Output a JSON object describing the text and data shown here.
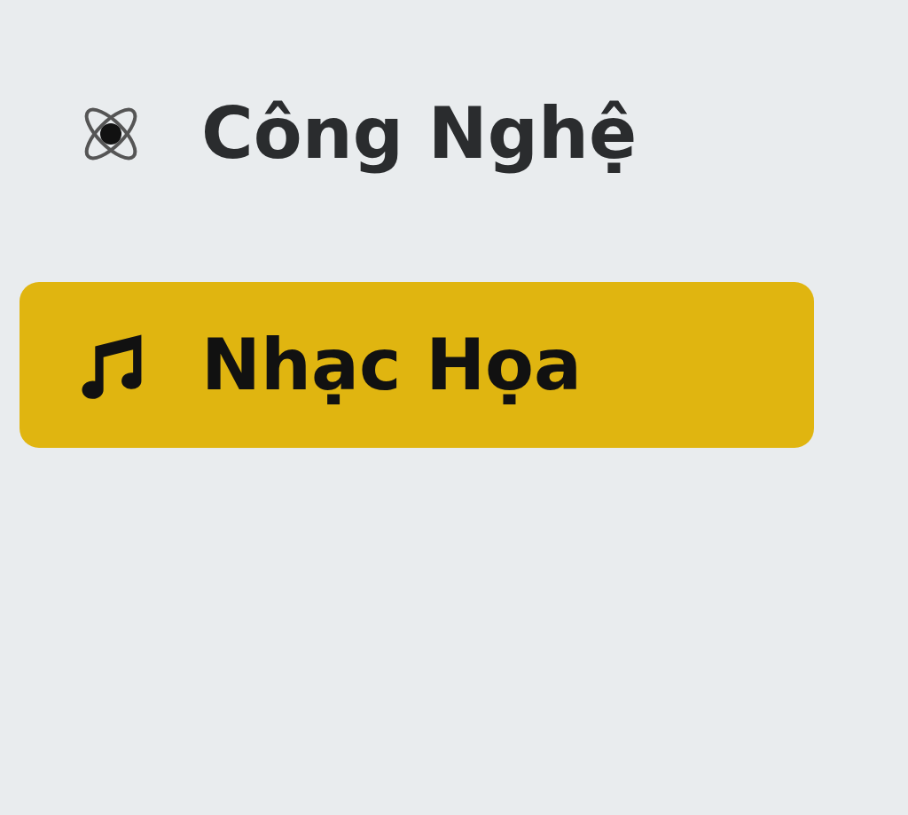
{
  "sidebar": {
    "items": [
      {
        "label": "Công Nghệ",
        "selected": false
      },
      {
        "label": "Nhạc Họa",
        "selected": true
      }
    ]
  }
}
